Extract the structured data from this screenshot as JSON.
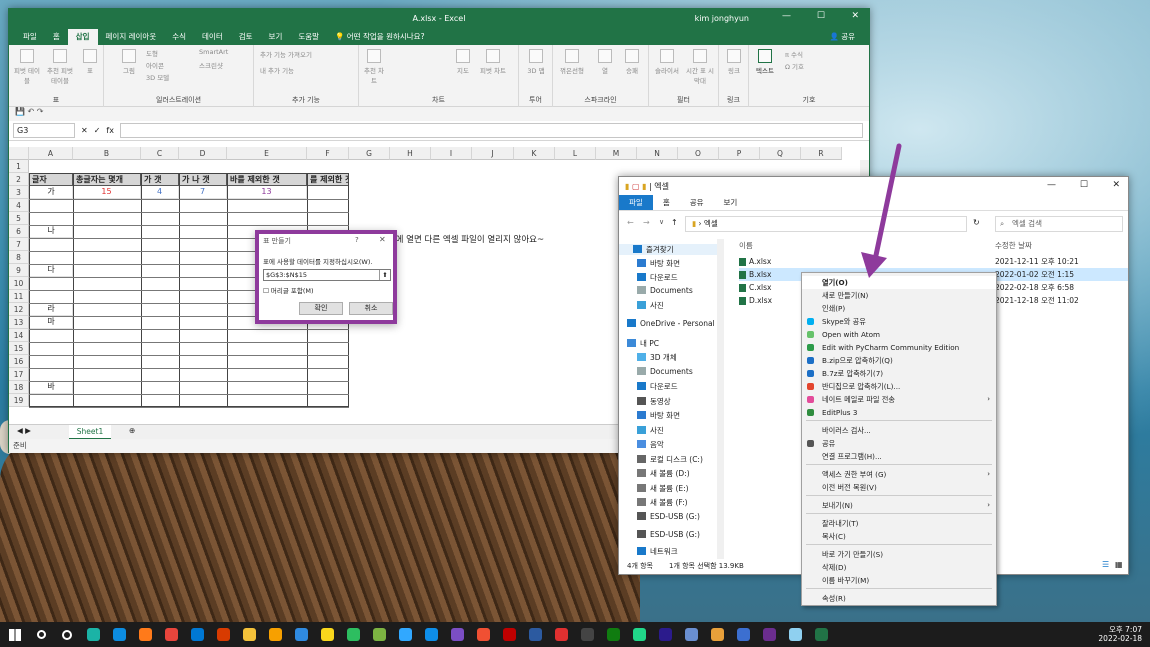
{
  "excel": {
    "title": "A.xlsx  -  Excel",
    "user": "kim jonghyun",
    "tabs": [
      "파일",
      "홈",
      "삽입",
      "페이지 레이아웃",
      "수식",
      "데이터",
      "검토",
      "보기",
      "도움말",
      "어떤 작업을 원하시나요?"
    ],
    "share": "공유",
    "ribbon_groups": [
      {
        "label": "표",
        "items": [
          "피벗 테이블",
          "추천 피벗 테이블",
          "표"
        ]
      },
      {
        "label": "일러스트레이션",
        "items": [
          "그림",
          "도형",
          "아이콘",
          "3D 모델",
          "SmartArt",
          "스크린샷"
        ]
      },
      {
        "label": "추가 기능",
        "items": [
          "추가 기능 가져오기",
          "내 추가 기능"
        ]
      },
      {
        "label": "차트",
        "items": [
          "추천 차트",
          "지도",
          "피벗 차트"
        ]
      },
      {
        "label": "투어",
        "items": [
          "3D 맵"
        ]
      },
      {
        "label": "스파크라인",
        "items": [
          "꺾은선형",
          "열",
          "승패"
        ]
      },
      {
        "label": "필터",
        "items": [
          "슬라이서",
          "시간 표 시 막대"
        ]
      },
      {
        "label": "링크",
        "items": [
          "링크"
        ]
      },
      {
        "label": "기호",
        "items": [
          "텍스트",
          "수식",
          "기호"
        ]
      }
    ],
    "name_box": "G3",
    "columns": [
      "A",
      "B",
      "C",
      "D",
      "E",
      "F",
      "G",
      "H",
      "I",
      "J",
      "K",
      "L",
      "M",
      "N",
      "O",
      "P",
      "Q",
      "R"
    ],
    "rows": [
      "1",
      "2",
      "3",
      "4",
      "5",
      "6",
      "7",
      "8",
      "9",
      "10",
      "11",
      "12",
      "13",
      "14",
      "15",
      "16",
      "17",
      "18",
      "19"
    ],
    "table_headers": [
      "글자",
      "총글자는 몇개",
      "가 갯",
      "가 나 갯",
      "바를 제외한 갯",
      "를 제외한 갯수"
    ],
    "row3": {
      "a": "가",
      "b": "15",
      "c": "4",
      "d": "7",
      "e": "13"
    },
    "col_a": {
      "r6": "나",
      "r9": "다",
      "r12": "라",
      "r13": "마",
      "r18": "바"
    },
    "note": "도중에 열면 다른 엑셀 파일이 열리지 않아요~",
    "sheet": "Sheet1",
    "status": "준비"
  },
  "dialog": {
    "title": "표 만들기",
    "question": "?",
    "prompt": "표에 사용할 데이터를 지정하십시오(W).",
    "range": "$G$3:$N$15",
    "checkbox": "머리글 포함(M)",
    "ok": "확인",
    "cancel": "취소"
  },
  "explorer": {
    "title": "엑셀",
    "ribbon": [
      "파일",
      "홈",
      "공유",
      "보기"
    ],
    "address": "엑셀",
    "search_placeholder": "엑셀 검색",
    "nav": [
      "즐겨찾기",
      "바탕 화면",
      "다운로드",
      "Documents",
      "사진",
      "OneDrive - Personal",
      "내 PC",
      "3D 개체",
      "Documents",
      "다운로드",
      "동영상",
      "바탕 화면",
      "사진",
      "음악",
      "로컬 디스크 (C:)",
      "새 볼륨 (D:)",
      "새 볼륨 (E:)",
      "새 볼륨 (F:)",
      "ESD-USB (G:)",
      "ESD-USB (G:)",
      "네트워크"
    ],
    "col_name": "이름",
    "col_date": "수정한 날짜",
    "files": [
      {
        "name": "A.xlsx",
        "date": "2021-12-11 오후 10:21"
      },
      {
        "name": "B.xlsx",
        "date": "2022-01-02 오전 1:15"
      },
      {
        "name": "C.xlsx",
        "date": "2022-02-18 오후 6:58"
      },
      {
        "name": "D.xlsx",
        "date": "2021-12-18 오전 11:02"
      }
    ],
    "status_count": "4개 항목",
    "status_sel": "1개 항목 선택함 13.9KB"
  },
  "context_menu": [
    "열기(O)",
    "새로 만들기(N)",
    "인쇄(P)",
    "Skype와 공유",
    "Open with Atom",
    "Edit with PyCharm Community Edition",
    "B.zip으로 압축하기(Q)",
    "B.7z로 압축하기(7)",
    "반디집으로 압축하기(L)...",
    "네이트 메일로 파일 전송",
    "EditPlus 3",
    "바이러스 검사...",
    "공유",
    "연결 프로그램(H)...",
    "액세스 권한 부여 (G)",
    "이전 버전 복원(V)",
    "보내기(N)",
    "잘라내기(T)",
    "복사(C)",
    "바로 가기 만들기(S)",
    "삭제(D)",
    "이름 바꾸기(M)",
    "속성(R)"
  ],
  "clock": {
    "time": "오후 7:07",
    "date": "2022-02-18"
  },
  "colors": {
    "excel_green": "#217346",
    "highlight": "#8e3a9c",
    "blue_num": "#4472c4",
    "red_num": "#e03030"
  }
}
